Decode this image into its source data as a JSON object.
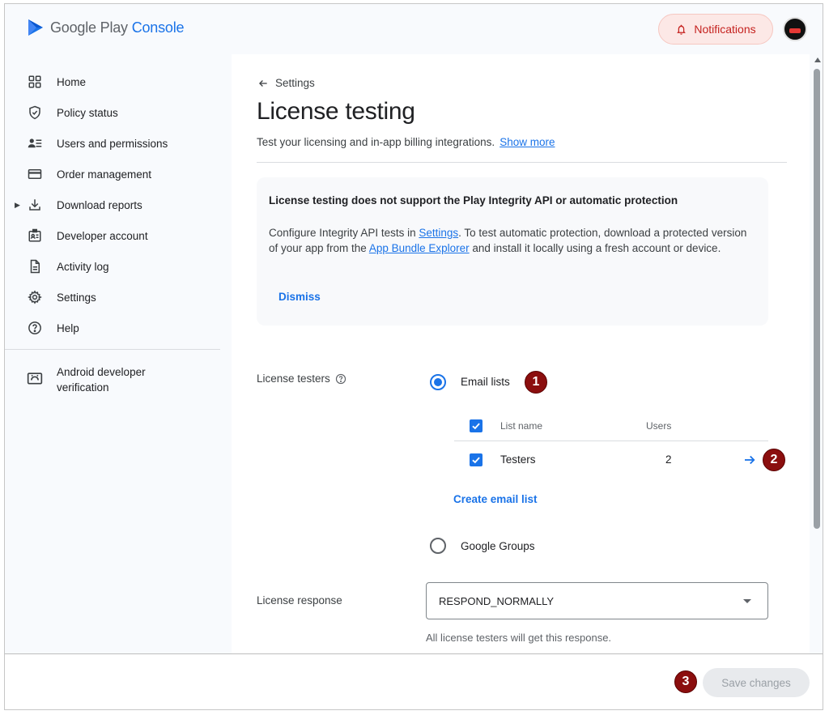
{
  "header": {
    "logo_word1": "Google Play",
    "logo_word2": "Console",
    "notifications_label": "Notifications"
  },
  "sidebar": {
    "items": [
      {
        "label": "Home",
        "icon": "grid-icon"
      },
      {
        "label": "Policy status",
        "icon": "shield-icon"
      },
      {
        "label": "Users and permissions",
        "icon": "users-icon"
      },
      {
        "label": "Order management",
        "icon": "credit-card-icon"
      },
      {
        "label": "Download reports",
        "icon": "download-icon"
      },
      {
        "label": "Developer account",
        "icon": "id-card-icon"
      },
      {
        "label": "Activity log",
        "icon": "document-icon"
      },
      {
        "label": "Settings",
        "icon": "gear-icon"
      },
      {
        "label": "Help",
        "icon": "help-icon"
      }
    ],
    "extra_item": {
      "label": "Android developer verification",
      "icon": "android-icon"
    }
  },
  "main": {
    "back_label": "Settings",
    "title": "License testing",
    "subtitle": "Test your licensing and in-app billing integrations.",
    "show_more": "Show more",
    "banner": {
      "title": "License testing does not support the Play Integrity API or automatic protection",
      "body_part1": "Configure Integrity API tests in ",
      "link_settings": "Settings",
      "body_part2": ". To test automatic protection, download a protected version of your app from the ",
      "link_explorer": "App Bundle Explorer",
      "body_part3": " and install it locally using a fresh account or device.",
      "dismiss": "Dismiss"
    },
    "license_testers": {
      "label": "License testers",
      "option_email": "Email lists",
      "option_groups": "Google Groups",
      "table": {
        "col_name": "List name",
        "col_users": "Users",
        "rows": [
          {
            "name": "Testers",
            "users": "2"
          }
        ]
      },
      "create_link": "Create email list"
    },
    "license_response": {
      "label": "License response",
      "selected": "RESPOND_NORMALLY",
      "helper": "All license testers will get this response."
    }
  },
  "footer": {
    "save_label": "Save changes"
  },
  "markers": [
    "1",
    "2",
    "3"
  ],
  "colors": {
    "accent": "#1a73e8",
    "marker": "#8b0e0e",
    "notification_bg": "#fce8e6",
    "notification_text": "#c5221f"
  }
}
